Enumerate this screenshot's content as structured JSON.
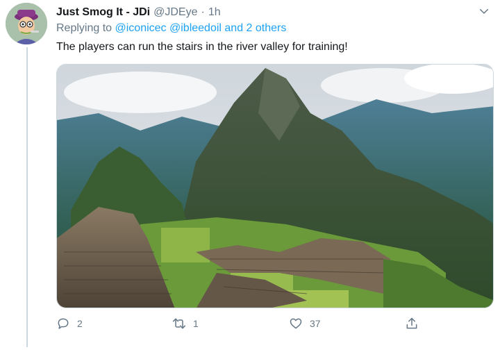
{
  "tweet": {
    "display_name": "Just Smog It - JDi",
    "handle": "@JDEye",
    "separator": "·",
    "time": "1h",
    "replying_prefix": "Replying to",
    "replying_to": [
      "@iconicec",
      "@ibleedoil"
    ],
    "replying_and_others": "and 2 others",
    "text": "The players can run the stairs in the river valley for training!",
    "image_description_icon": "mountain-ruins-photo"
  },
  "actions": {
    "reply_count": "2",
    "retweet_count": "1",
    "like_count": "37",
    "share_count": ""
  },
  "colors": {
    "link": "#1da1f2",
    "muted": "#657786",
    "text": "#14171a",
    "border": "#ccd6dd"
  },
  "icons": {
    "reply": "speech-bubble-icon",
    "retweet": "retweet-arrows-icon",
    "like": "heart-icon",
    "share": "share-upload-icon",
    "menu": "chevron-down-icon"
  }
}
